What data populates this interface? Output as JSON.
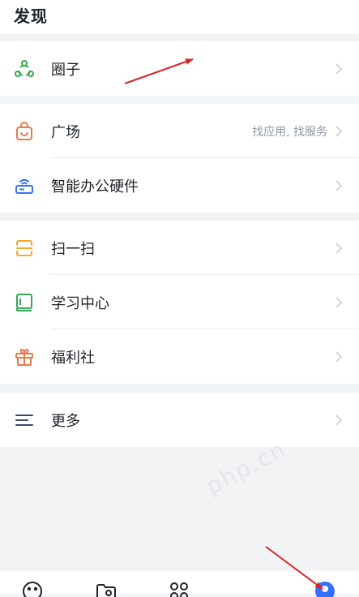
{
  "header": {
    "title": "发现"
  },
  "groups": [
    {
      "items": [
        {
          "label": "圈子",
          "icon": "circle-group-icon",
          "color": "#34a853"
        }
      ]
    },
    {
      "items": [
        {
          "label": "广场",
          "hint": "找应用, 找服务",
          "icon": "shopping-bag-icon",
          "color": "#e8794a"
        },
        {
          "label": "智能办公硬件",
          "icon": "router-icon",
          "color": "#3370ff"
        }
      ]
    },
    {
      "items": [
        {
          "label": "扫一扫",
          "icon": "scan-icon",
          "color": "#f5a623"
        },
        {
          "label": "学习中心",
          "icon": "book-icon",
          "color": "#34a853"
        },
        {
          "label": "福利社",
          "icon": "gift-icon",
          "color": "#e8794a"
        }
      ]
    },
    {
      "items": [
        {
          "label": "更多",
          "icon": "menu-icon",
          "color": "#3b4a6b"
        }
      ]
    }
  ],
  "bottom_nav": [
    {
      "icon": "smiley-icon"
    },
    {
      "icon": "folder-icon"
    },
    {
      "icon": "apps-grid-icon"
    },
    {
      "icon": "avatar-icon"
    }
  ],
  "annotations": {
    "arrow_color": "#d9262c"
  },
  "watermark": "php.cn"
}
